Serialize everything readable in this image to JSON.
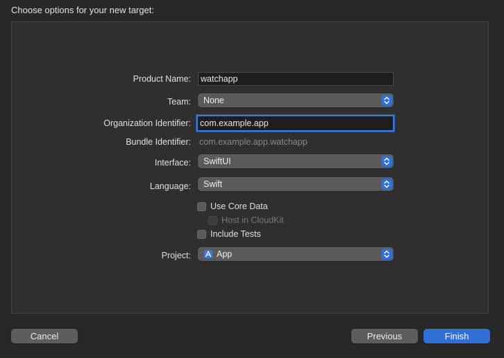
{
  "window": {
    "title": "Choose options for your new target:"
  },
  "form": {
    "product_name": {
      "label": "Product Name:",
      "value": "watchapp"
    },
    "team": {
      "label": "Team:",
      "value": "None"
    },
    "organization_identifier": {
      "label": "Organization Identifier:",
      "value": "com.example.app"
    },
    "bundle_identifier": {
      "label": "Bundle Identifier:",
      "value": "com.example.app.watchapp"
    },
    "interface": {
      "label": "Interface:",
      "value": "SwiftUI"
    },
    "language": {
      "label": "Language:",
      "value": "Swift"
    },
    "options": {
      "use_core_data": {
        "label": "Use Core Data",
        "checked": false,
        "enabled": true
      },
      "host_in_cloudkit": {
        "label": "Host in CloudKit",
        "checked": false,
        "enabled": false
      },
      "include_tests": {
        "label": "Include Tests",
        "checked": false,
        "enabled": true
      }
    },
    "project": {
      "label": "Project:",
      "value": "App",
      "icon": "xcode-project-icon"
    }
  },
  "footer": {
    "cancel_label": "Cancel",
    "previous_label": "Previous",
    "finish_label": "Finish"
  },
  "colors": {
    "accent": "#2f6fd6",
    "background": "#282828",
    "panel": "#2f2f2f"
  }
}
